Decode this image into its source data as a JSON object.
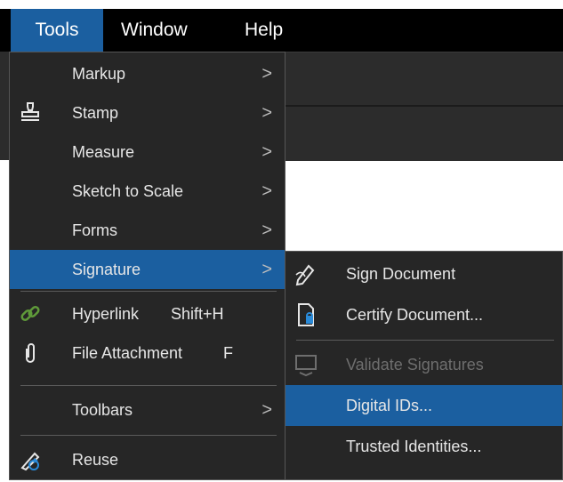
{
  "menubar": {
    "items": [
      {
        "label": "Tools"
      },
      {
        "label": "Window"
      },
      {
        "label": "Help"
      }
    ]
  },
  "tools_menu": {
    "items": [
      {
        "label": "Markup",
        "arrow": ">"
      },
      {
        "label": "Stamp",
        "arrow": ">",
        "icon": "stamp-icon"
      },
      {
        "label": "Measure",
        "arrow": ">"
      },
      {
        "label": "Sketch to Scale",
        "arrow": ">"
      },
      {
        "label": "Forms",
        "arrow": ">"
      },
      {
        "label": "Signature",
        "arrow": ">",
        "highlighted": true
      },
      {
        "label": "Hyperlink",
        "shortcut": "Shift+H",
        "icon": "hyperlink-icon"
      },
      {
        "label": "File Attachment",
        "shortcut": "F",
        "icon": "paperclip-icon"
      },
      {
        "label": "Toolbars",
        "arrow": ">"
      },
      {
        "label": "Reuse",
        "icon": "reuse-icon"
      }
    ]
  },
  "signature_submenu": {
    "items": [
      {
        "label": "Sign Document",
        "icon": "sign-pen-icon"
      },
      {
        "label": "Certify Document...",
        "icon": "certify-document-icon"
      },
      {
        "label": "Validate Signatures",
        "icon": "validate-signatures-icon",
        "disabled": true
      },
      {
        "label": "Digital IDs...",
        "highlighted": true
      },
      {
        "label": "Trusted Identities..."
      }
    ]
  },
  "colors": {
    "highlight": "#1b5fa0",
    "menu_bg": "#262626",
    "menubar_bg": "#000000",
    "hyperlink_icon": "#5f9a3a",
    "certify_icon_accent": "#2a8ad8"
  }
}
